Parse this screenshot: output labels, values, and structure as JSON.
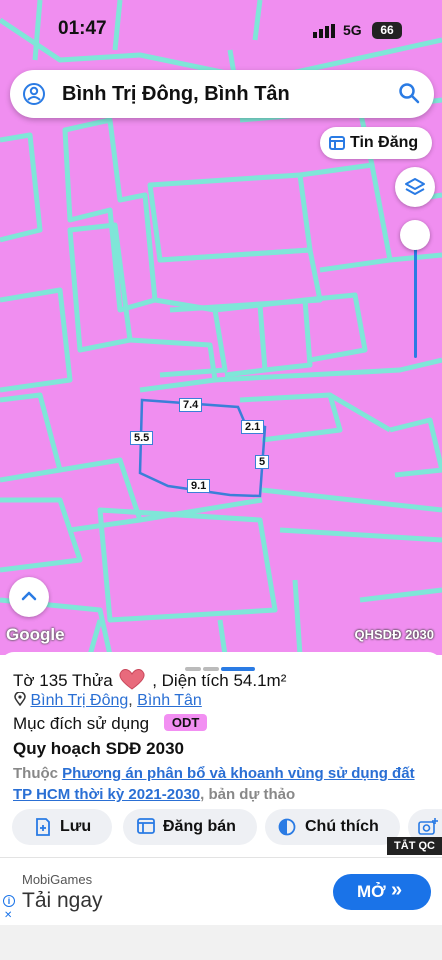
{
  "status_bar": {
    "time": "01:47",
    "network": "5G",
    "battery": "66"
  },
  "search": {
    "location": "Bình Trị Đông, Bình Tân"
  },
  "map": {
    "tin_dang_label": "Tin Đăng",
    "google_label": "Google",
    "layer_label": "QHSDĐ 2030",
    "dimensions": {
      "top": "7.4",
      "left": "5.5",
      "right_top": "2.1",
      "right": "5",
      "bottom": "9.1"
    },
    "colors": {
      "land": "#f08ef0",
      "road": "#7fe6d8",
      "parcel_outline": "#3a7fd8"
    }
  },
  "sheet": {
    "to_label": "Tờ 135 Thửa",
    "area_label": ", Diện tích 54.1m²",
    "ward_link": "Bình Trị Đông",
    "separator": ", ",
    "district_link": "Bình Tân",
    "purpose_label": "Mục đích sử dụng",
    "purpose_badge": "ODT",
    "plan_label": "Quy hoạch SDĐ 2030",
    "belongs_prefix": "Thuộc ",
    "plan_link": "Phương án phân bổ và khoanh vùng sử dụng đất TP HCM thời kỳ 2021-2030",
    "belongs_suffix": ", bản dự thảo",
    "actions": {
      "save": "Lưu",
      "post": "Đăng bán",
      "legend": "Chú thích"
    },
    "hide_ads": "TẮT QC"
  },
  "ad": {
    "brand": "MobiGames",
    "text": "Tải ngay",
    "button": "MỞ"
  }
}
